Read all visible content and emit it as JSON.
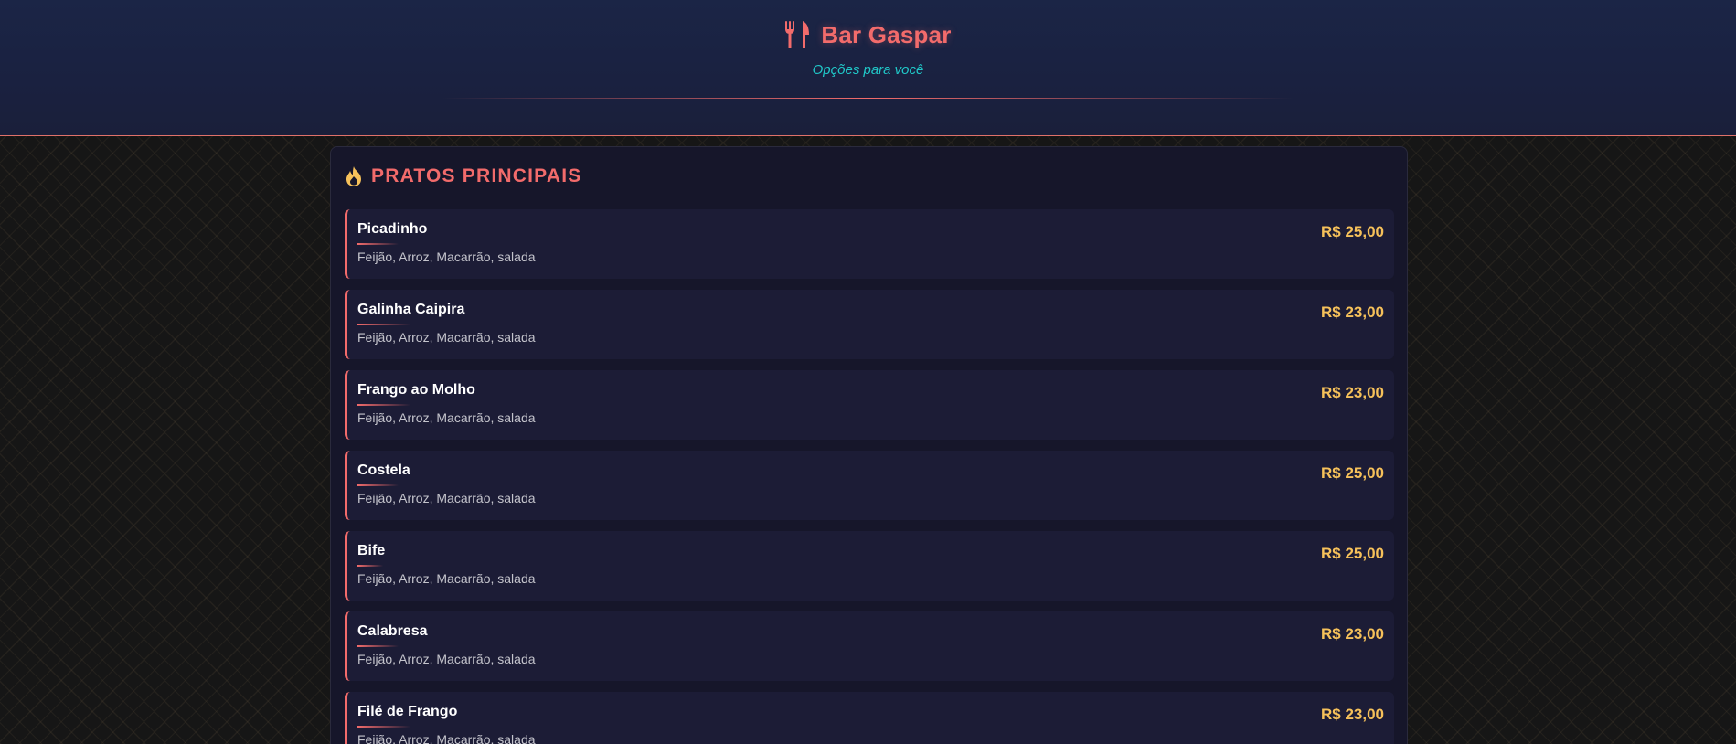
{
  "header": {
    "title": "Bar Gaspar",
    "subtitle": "Opções para você",
    "icon": "utensils-icon"
  },
  "section": {
    "title": "PRATOS PRINCIPAIS",
    "icon": "fire-icon"
  },
  "colors": {
    "accent": "#f26b6b",
    "price": "#f6c15a",
    "subtitle": "#20c8c8"
  },
  "items": [
    {
      "name": "Picadinho",
      "desc": "Feijão, Arroz, Macarrão, salada",
      "price": "R$ 25,00"
    },
    {
      "name": "Galinha Caipira",
      "desc": "Feijão, Arroz, Macarrão, salada",
      "price": "R$ 23,00"
    },
    {
      "name": "Frango ao Molho",
      "desc": "Feijão, Arroz, Macarrão, salada",
      "price": "R$ 23,00"
    },
    {
      "name": "Costela",
      "desc": "Feijão, Arroz, Macarrão, salada",
      "price": "R$ 25,00"
    },
    {
      "name": "Bife",
      "desc": "Feijão, Arroz, Macarrão, salada",
      "price": "R$ 25,00"
    },
    {
      "name": "Calabresa",
      "desc": "Feijão, Arroz, Macarrão, salada",
      "price": "R$ 23,00"
    },
    {
      "name": "Filé de Frango",
      "desc": "Feijão, Arroz, Macarrão, salada",
      "price": "R$ 23,00"
    }
  ]
}
